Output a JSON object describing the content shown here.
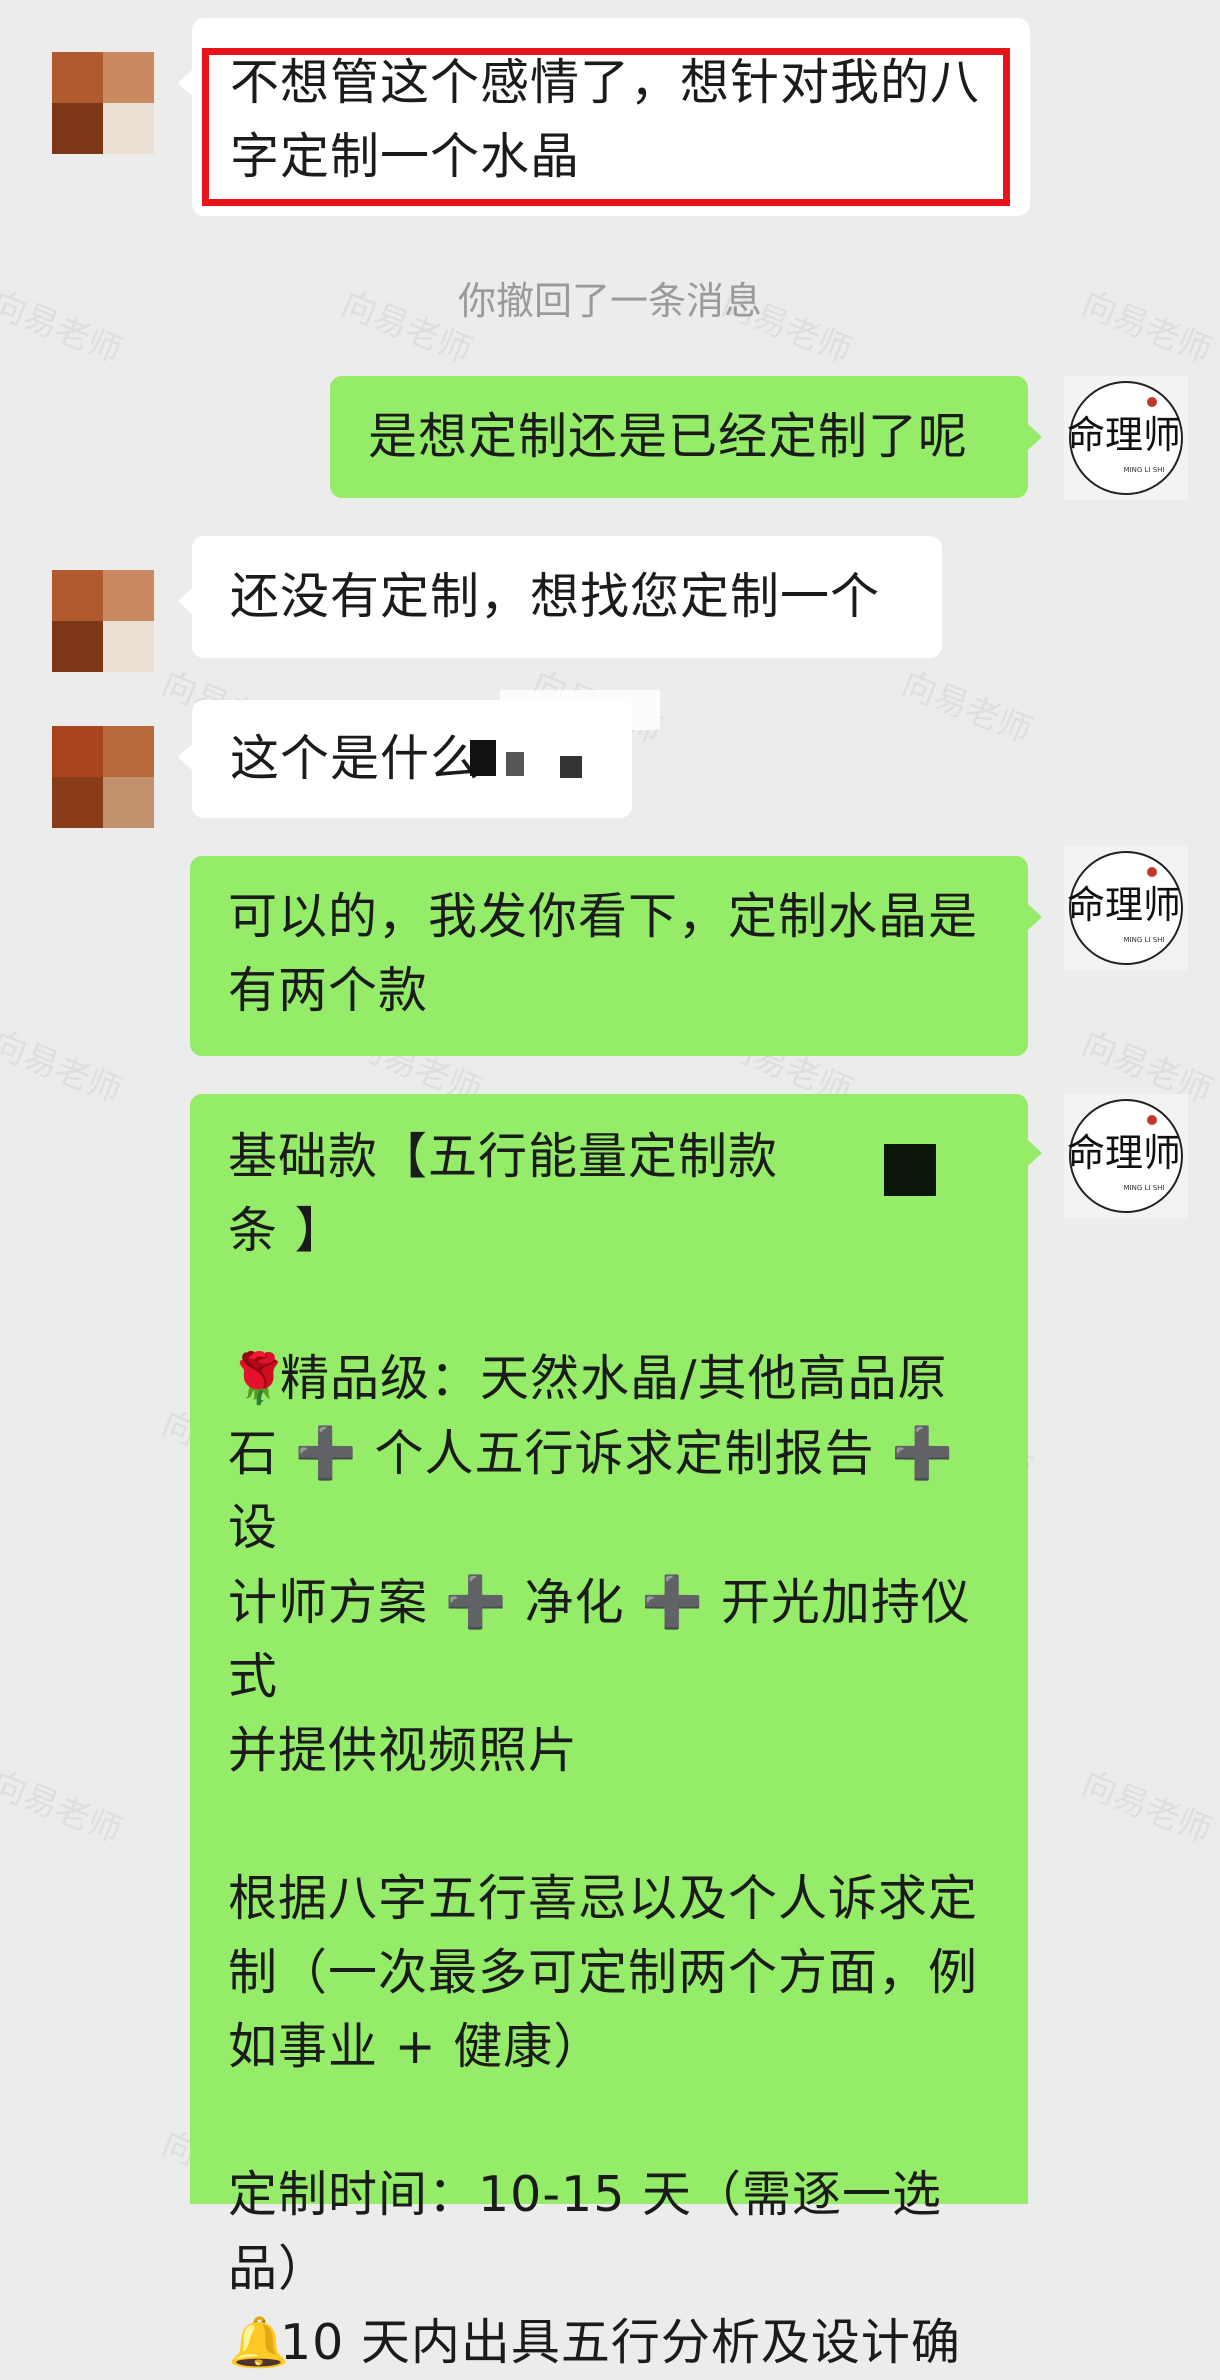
{
  "watermark": "向易老师",
  "colors": {
    "background": "#ececec",
    "bubble_outgoing": "#95ec69",
    "bubble_incoming": "#ffffff",
    "highlight_box": "#e8141b"
  },
  "messages": [
    {
      "side": "left",
      "text": "不想管这个感情了，想针对我的八字定制一个水晶"
    },
    {
      "side": "system",
      "text": "你撤回了一条消息"
    },
    {
      "side": "right",
      "text": "是想定制还是已经定制了呢"
    },
    {
      "side": "left",
      "text": "还没有定制，想找您定制一个"
    },
    {
      "side": "left",
      "text": "这个是什么"
    },
    {
      "side": "right",
      "text": "可以的，我发你看下，定制水晶是有两个款"
    },
    {
      "side": "right",
      "lines": [
        "基础款【五行能量定制款",
        "条 】",
        "",
        "精品级：天然水晶/其他高品原",
        "石",
        "个人五行诉求定制报告",
        "设",
        "计师方案",
        "净化",
        "开光加持仪式",
        "并提供视频照片",
        "",
        "根据八字五行喜忌以及个人诉求定",
        "制（一次最多可定制两个方面，例",
        "如事业 + 健康）",
        "",
        "定制时间：10-15 天（需逐一选品）",
        "10 天内出具五行分析及设计确"
      ]
    }
  ],
  "icons": {
    "rose": "🌹",
    "plus": "➕",
    "bell": "🔔"
  },
  "logo": {
    "title": "命理师",
    "sub": "MING LI SHI"
  }
}
